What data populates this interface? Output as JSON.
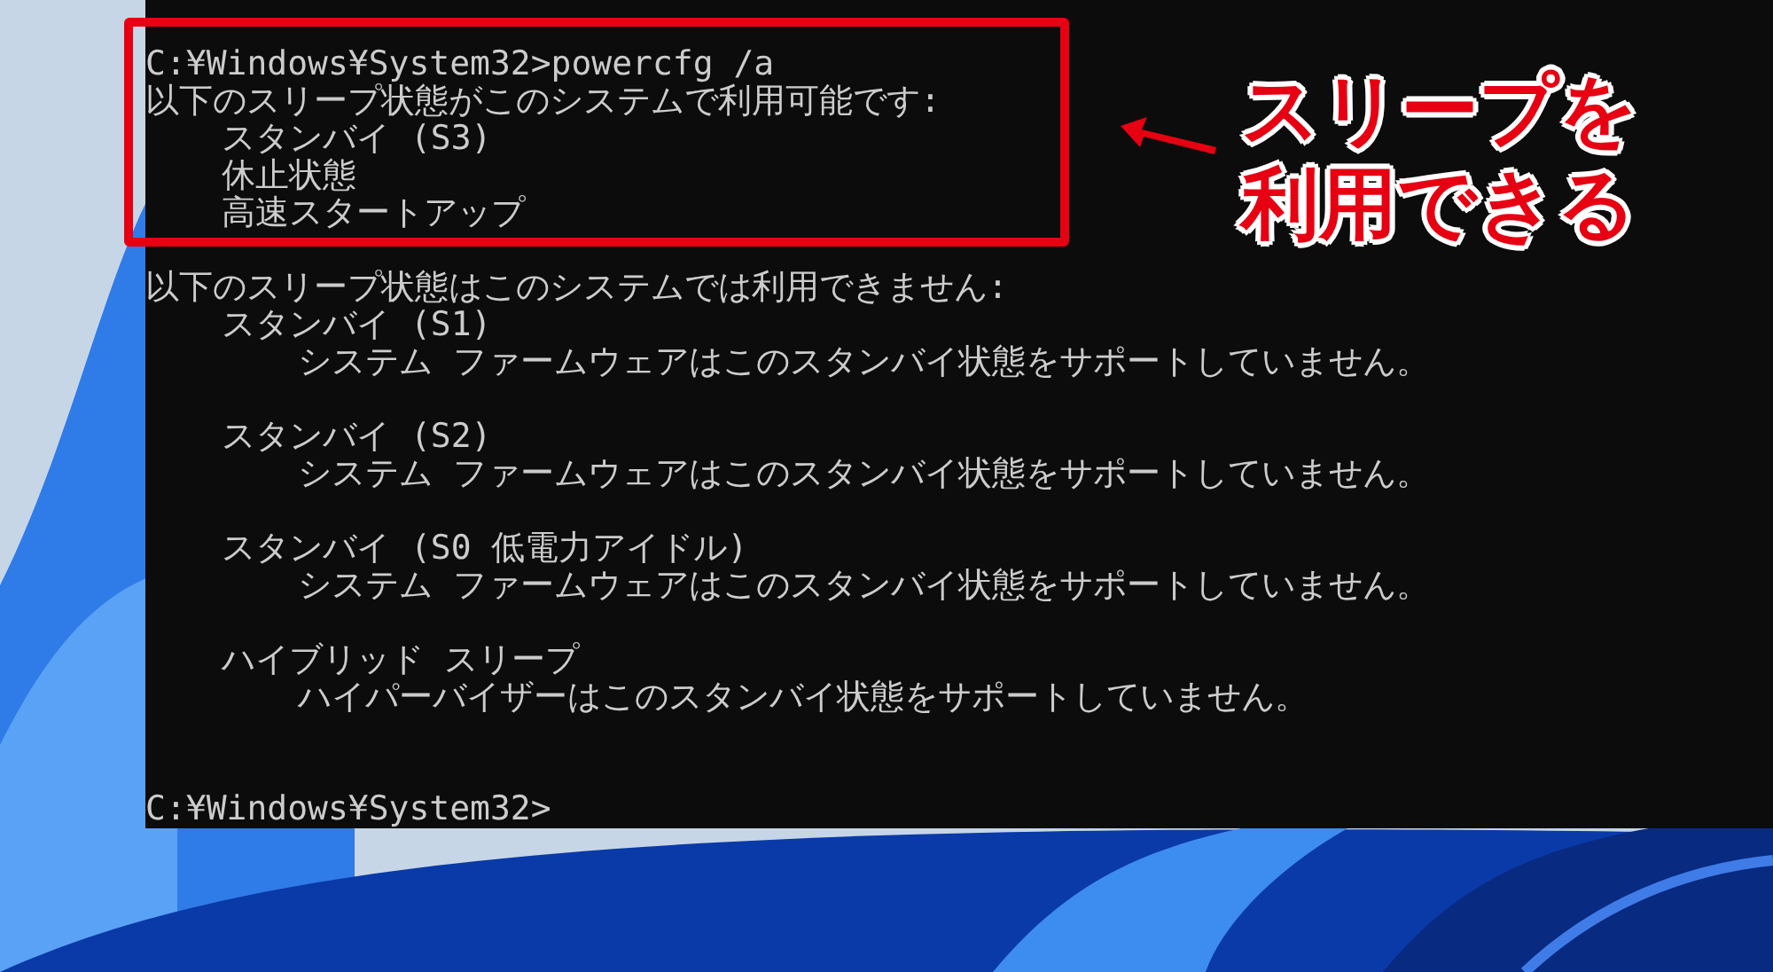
{
  "terminal": {
    "command_line": "C:¥Windows¥System32>powercfg /a",
    "available": {
      "heading": "以下のスリープ状態がこのシステムで利用可能です:",
      "items": [
        "スタンバイ (S3)",
        "休止状態",
        "高速スタートアップ"
      ]
    },
    "unavailable": {
      "heading": "以下のスリープ状態はこのシステムでは利用できません:",
      "items": [
        {
          "name": "スタンバイ (S1)",
          "reason": "システム ファームウェアはこのスタンバイ状態をサポートしていません。"
        },
        {
          "name": "スタンバイ (S2)",
          "reason": "システム ファームウェアはこのスタンバイ状態をサポートしていません。"
        },
        {
          "name": "スタンバイ (S0 低電力アイドル)",
          "reason": "システム ファームウェアはこのスタンバイ状態をサポートしていません。"
        },
        {
          "name": "ハイブリッド スリープ",
          "reason": "ハイパーバイザーはこのスタンバイ状態をサポートしていません。"
        }
      ]
    },
    "prompt": "C:¥Windows¥System32>"
  },
  "callout": {
    "lines": [
      "スリープを",
      "利用できる"
    ]
  }
}
